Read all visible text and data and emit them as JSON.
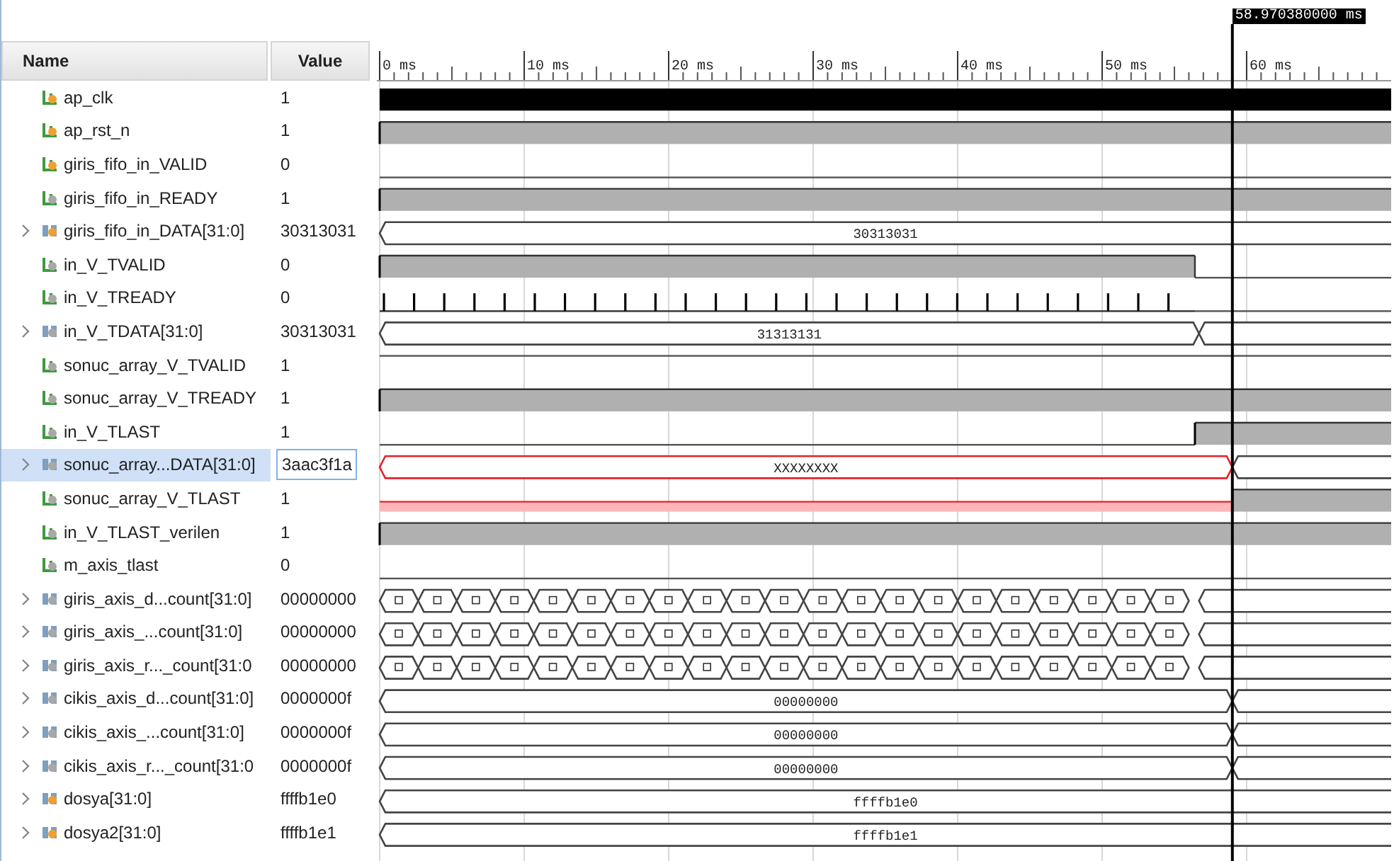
{
  "columns": [
    "Name",
    "Value"
  ],
  "cursor": {
    "label": "58.970380000 ms",
    "level": 0.843
  },
  "ruler": [
    {
      "label": "0 ms",
      "level": 0
    },
    {
      "label": "10 ms",
      "level": 0.1429
    },
    {
      "label": "20 ms",
      "level": 0.2857
    },
    {
      "label": "30 ms",
      "level": 0.4286
    },
    {
      "label": "40 ms",
      "level": 0.5714
    },
    {
      "label": "50 ms",
      "level": 0.7143
    },
    {
      "label": "60 ms",
      "level": 0.8571
    }
  ],
  "signals": [
    {
      "name": "ap_clk",
      "value": "1",
      "kind": "bit",
      "color": "#f0a030",
      "expandable": false,
      "selected": false,
      "wave": [
        {
          "kind": "clock",
          "level": 1
        }
      ]
    },
    {
      "name": "ap_rst_n",
      "value": "1",
      "kind": "bit",
      "color": "#f0a030",
      "expandable": false,
      "selected": false,
      "wave": [
        {
          "kind": "high",
          "level": 1
        }
      ]
    },
    {
      "name": "giris_fifo_in_VALID",
      "value": "0",
      "kind": "bit",
      "color": "#f0a030",
      "expandable": false,
      "selected": false,
      "wave": [
        {
          "kind": "low",
          "level": 1
        }
      ]
    },
    {
      "name": "giris_fifo_in_READY",
      "value": "1",
      "kind": "bit",
      "color": "#a8a8a8",
      "expandable": false,
      "selected": false,
      "wave": [
        {
          "kind": "high",
          "level": 1
        }
      ]
    },
    {
      "name": "giris_fifo_in_DATA[31:0]",
      "value": "30313031",
      "kind": "bus",
      "color": "#f0a030",
      "expandable": true,
      "selected": false,
      "wave": [
        {
          "kind": "bus",
          "label": "30313031",
          "level": 1
        }
      ]
    },
    {
      "name": "in_V_TVALID",
      "value": "0",
      "kind": "bit",
      "color": "#a8a8a8",
      "expandable": false,
      "selected": false,
      "wave": [
        {
          "kind": "high",
          "level": 0.806
        },
        {
          "kind": "low",
          "level": 1
        }
      ]
    },
    {
      "name": "in_V_TREADY",
      "value": "0",
      "kind": "bit",
      "color": "#a8a8a8",
      "expandable": false,
      "selected": false,
      "wave": [
        {
          "kind": "pulses",
          "level": 0.806
        },
        {
          "kind": "low",
          "level": 1
        }
      ]
    },
    {
      "name": "in_V_TDATA[31:0]",
      "value": "30313031",
      "kind": "bus",
      "color": "#a8a8a8",
      "expandable": true,
      "selected": false,
      "wave": [
        {
          "kind": "bus",
          "label": "31313131",
          "level": 0.81
        },
        {
          "kind": "bus",
          "level": 1
        }
      ]
    },
    {
      "name": "sonuc_array_V_TVALID",
      "value": "1",
      "kind": "bit",
      "color": "#a8a8a8",
      "expandable": false,
      "selected": false,
      "wave": [
        {
          "kind": "line",
          "level": 1
        }
      ]
    },
    {
      "name": "sonuc_array_V_TREADY",
      "value": "1",
      "kind": "bit",
      "color": "#a8a8a8",
      "expandable": false,
      "selected": false,
      "wave": [
        {
          "kind": "high",
          "level": 1
        }
      ]
    },
    {
      "name": "in_V_TLAST",
      "value": "1",
      "kind": "bit",
      "color": "#a8a8a8",
      "expandable": false,
      "selected": false,
      "wave": [
        {
          "kind": "low",
          "level": 0.806
        },
        {
          "kind": "high",
          "level": 1
        }
      ]
    },
    {
      "name": "sonuc_array...DATA[31:0]",
      "value": "3aac3f1a",
      "kind": "bus",
      "color": "#a8a8a8",
      "expandable": true,
      "selected": true,
      "wave": [
        {
          "kind": "x",
          "label": "XXXXXXXX",
          "level": 0.843
        },
        {
          "kind": "bus",
          "level": 1
        }
      ]
    },
    {
      "name": "sonuc_array_V_TLAST",
      "value": "1",
      "kind": "bit",
      "color": "#a8a8a8",
      "expandable": false,
      "selected": false,
      "wave": [
        {
          "kind": "x",
          "level": 0.843
        },
        {
          "kind": "high",
          "level": 1
        }
      ]
    },
    {
      "name": "in_V_TLAST_verilen",
      "value": "1",
      "kind": "bit",
      "color": "#a8a8a8",
      "expandable": false,
      "selected": false,
      "wave": [
        {
          "kind": "high",
          "level": 1
        }
      ]
    },
    {
      "name": "m_axis_tlast",
      "value": "0",
      "kind": "bit",
      "color": "#a8a8a8",
      "expandable": false,
      "selected": false,
      "wave": [
        {
          "kind": "low",
          "level": 1
        }
      ]
    },
    {
      "name": "giris_axis_d...count[31:0]",
      "value": "00000000",
      "kind": "bus",
      "color": "#a8a8a8",
      "expandable": true,
      "selected": false,
      "wave": [
        {
          "kind": "train",
          "level": 0.81
        },
        {
          "kind": "bus",
          "level": 1
        }
      ]
    },
    {
      "name": "giris_axis_...count[31:0]",
      "value": "00000000",
      "kind": "bus",
      "color": "#a8a8a8",
      "expandable": true,
      "selected": false,
      "wave": [
        {
          "kind": "train",
          "level": 0.81
        },
        {
          "kind": "bus",
          "level": 1
        }
      ]
    },
    {
      "name": "giris_axis_r..._count[31:0",
      "value": "00000000",
      "kind": "bus",
      "color": "#a8a8a8",
      "expandable": true,
      "selected": false,
      "wave": [
        {
          "kind": "train",
          "level": 0.81
        },
        {
          "kind": "bus",
          "level": 1
        }
      ]
    },
    {
      "name": "cikis_axis_d...count[31:0]",
      "value": "0000000f",
      "kind": "bus",
      "color": "#a8a8a8",
      "expandable": true,
      "selected": false,
      "wave": [
        {
          "kind": "bus",
          "label": "00000000",
          "level": 0.843
        },
        {
          "kind": "bus",
          "level": 1
        }
      ]
    },
    {
      "name": "cikis_axis_...count[31:0]",
      "value": "0000000f",
      "kind": "bus",
      "color": "#a8a8a8",
      "expandable": true,
      "selected": false,
      "wave": [
        {
          "kind": "bus",
          "label": "00000000",
          "level": 0.843
        },
        {
          "kind": "bus",
          "level": 1
        }
      ]
    },
    {
      "name": "cikis_axis_r..._count[31:0",
      "value": "0000000f",
      "kind": "bus",
      "color": "#a8a8a8",
      "expandable": true,
      "selected": false,
      "wave": [
        {
          "kind": "bus",
          "label": "00000000",
          "level": 0.843
        },
        {
          "kind": "bus",
          "level": 1
        }
      ]
    },
    {
      "name": "dosya[31:0]",
      "value": "ffffb1e0",
      "kind": "bus",
      "color": "#f0a030",
      "expandable": true,
      "selected": false,
      "wave": [
        {
          "kind": "bus",
          "label": "ffffb1e0",
          "level": 1
        }
      ]
    },
    {
      "name": "dosya2[31:0]",
      "value": "ffffb1e1",
      "kind": "bus",
      "color": "#f0a030",
      "expandable": true,
      "selected": false,
      "wave": [
        {
          "kind": "bus",
          "label": "ffffb1e1",
          "level": 1
        }
      ]
    }
  ]
}
